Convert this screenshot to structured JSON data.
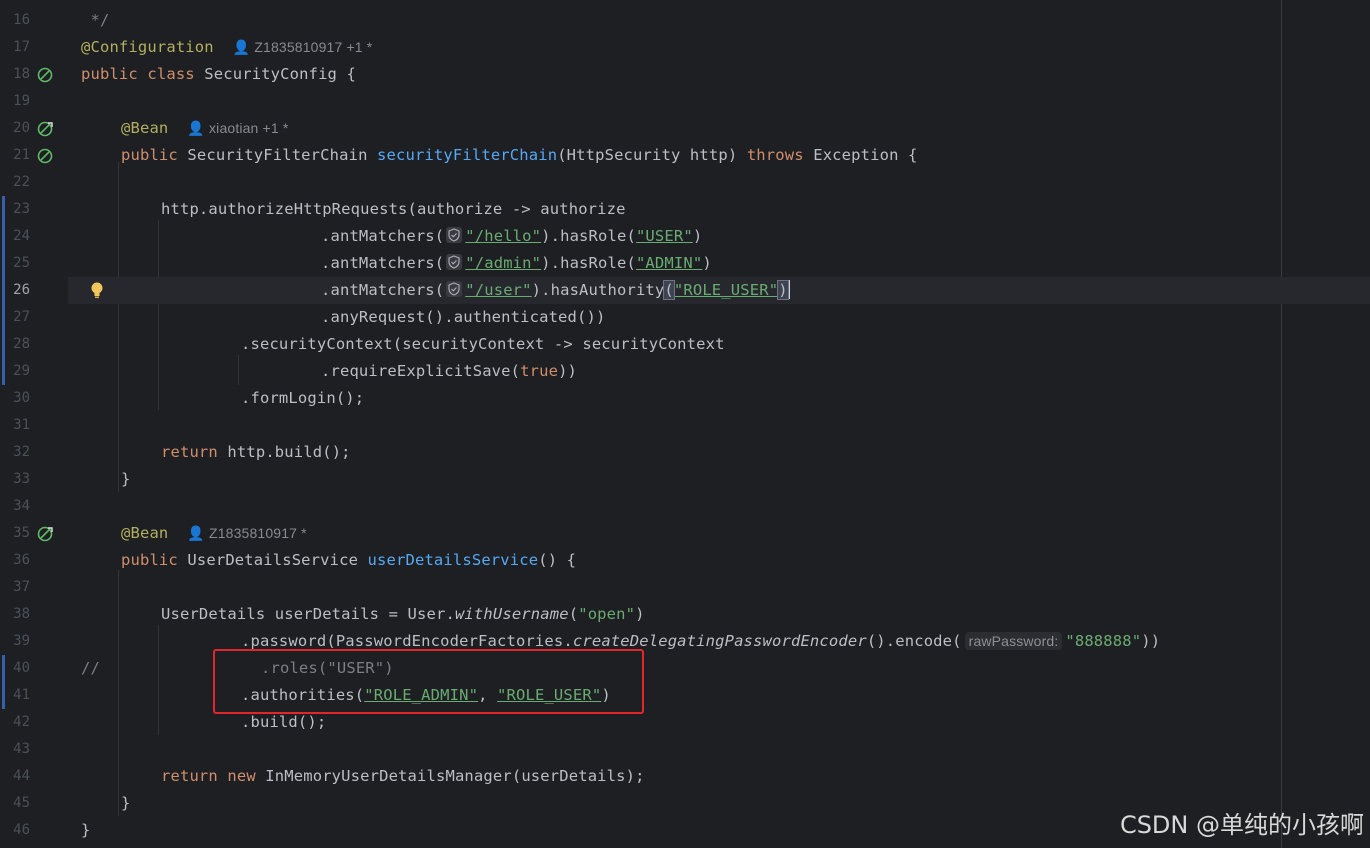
{
  "editor": {
    "theme": {
      "background": "#1e1f22",
      "keyword": "#cf8e6d",
      "annotation": "#b3ae60",
      "method": "#56a8f5",
      "string": "#6aab73",
      "default": "#bcbec4"
    },
    "line_numbers": [
      "16",
      "17",
      "18",
      "19",
      "20",
      "21",
      "22",
      "23",
      "24",
      "25",
      "26",
      "27",
      "28",
      "29",
      "30",
      "31",
      "32",
      "33",
      "34",
      "35",
      "36",
      "37",
      "38",
      "39",
      "40",
      "41",
      "42",
      "43",
      "44",
      "45",
      "46"
    ],
    "current_line": "26",
    "gutter_icons": {
      "line18": "spring-bean-icon",
      "line20": "spring-bean-navigate-icon",
      "line21": "spring-bean-icon",
      "line26": "lightbulb-intention-icon",
      "line35": "spring-bean-navigate-icon"
    },
    "lines": {
      "l16": " */",
      "l17_ann": "@Configuration",
      "l17_author": "Z1835810917 +1 *",
      "l18_kw": "public class",
      "l18_name": "SecurityConfig {",
      "l20_ann": "@Bean",
      "l20_author": "xiaotian +1 *",
      "l21_kw": "public",
      "l21_type": "SecurityFilterChain",
      "l21_fn": "securityFilterChain",
      "l21_params": "(HttpSecurity http)",
      "l21_throws": "throws",
      "l21_tail": "Exception {",
      "l23": "http.authorizeHttpRequests(authorize -> authorize",
      "l24_a": ".antMatchers(",
      "l24_s": "\"/hello\"",
      "l24_b": ").hasRole(",
      "l24_s2": "\"USER\"",
      "l24_c": ")",
      "l25_a": ".antMatchers(",
      "l25_s": "\"/admin\"",
      "l25_b": ").hasRole(",
      "l25_s2": "\"ADMIN\"",
      "l25_c": ")",
      "l26_a": ".antMatchers(",
      "l26_s": "\"/user\"",
      "l26_b": ").hasAuthority",
      "l26_p": "(",
      "l26_s2": "\"ROLE_USER\"",
      "l26_c": ")",
      "l27": ".anyRequest().authenticated())",
      "l28": ".securityContext(securityContext -> securityContext",
      "l29_a": ".requireExplicitSave(",
      "l29_kw": "true",
      "l29_b": "))",
      "l30": ".formLogin();",
      "l32_kw": "return",
      "l32_rest": " http.build();",
      "l33": "}",
      "l35_ann": "@Bean",
      "l35_author": "Z1835810917 *",
      "l36_kw": "public",
      "l36_type": " UserDetailsService ",
      "l36_fn": "userDetailsService",
      "l36_tail": "() {",
      "l38_a": "UserDetails userDetails = User.",
      "l38_it": "withUsername",
      "l38_b": "(",
      "l38_s": "\"open\"",
      "l38_c": ")",
      "l39_a": ".password(PasswordEncoderFactories.",
      "l39_it": "createDelegatingPasswordEncoder",
      "l39_b": "().encode(",
      "l39_hint": "rawPassword:",
      "l39_s": "\"888888\"",
      "l39_c": "))",
      "l40_cmt": "//",
      "l40_code": ".roles(\"USER\")",
      "l41_a": ".authorities(",
      "l41_s1": "\"ROLE_ADMIN\"",
      "l41_sep": ", ",
      "l41_s2": "\"ROLE_USER\"",
      "l41_c": ")",
      "l42": ".build();",
      "l44_kw": "return new",
      "l44_rest": " InMemoryUserDetailsManager(userDetails);",
      "l45": "}",
      "l46": "}"
    }
  },
  "watermark": "CSDN @单纯的小孩啊"
}
